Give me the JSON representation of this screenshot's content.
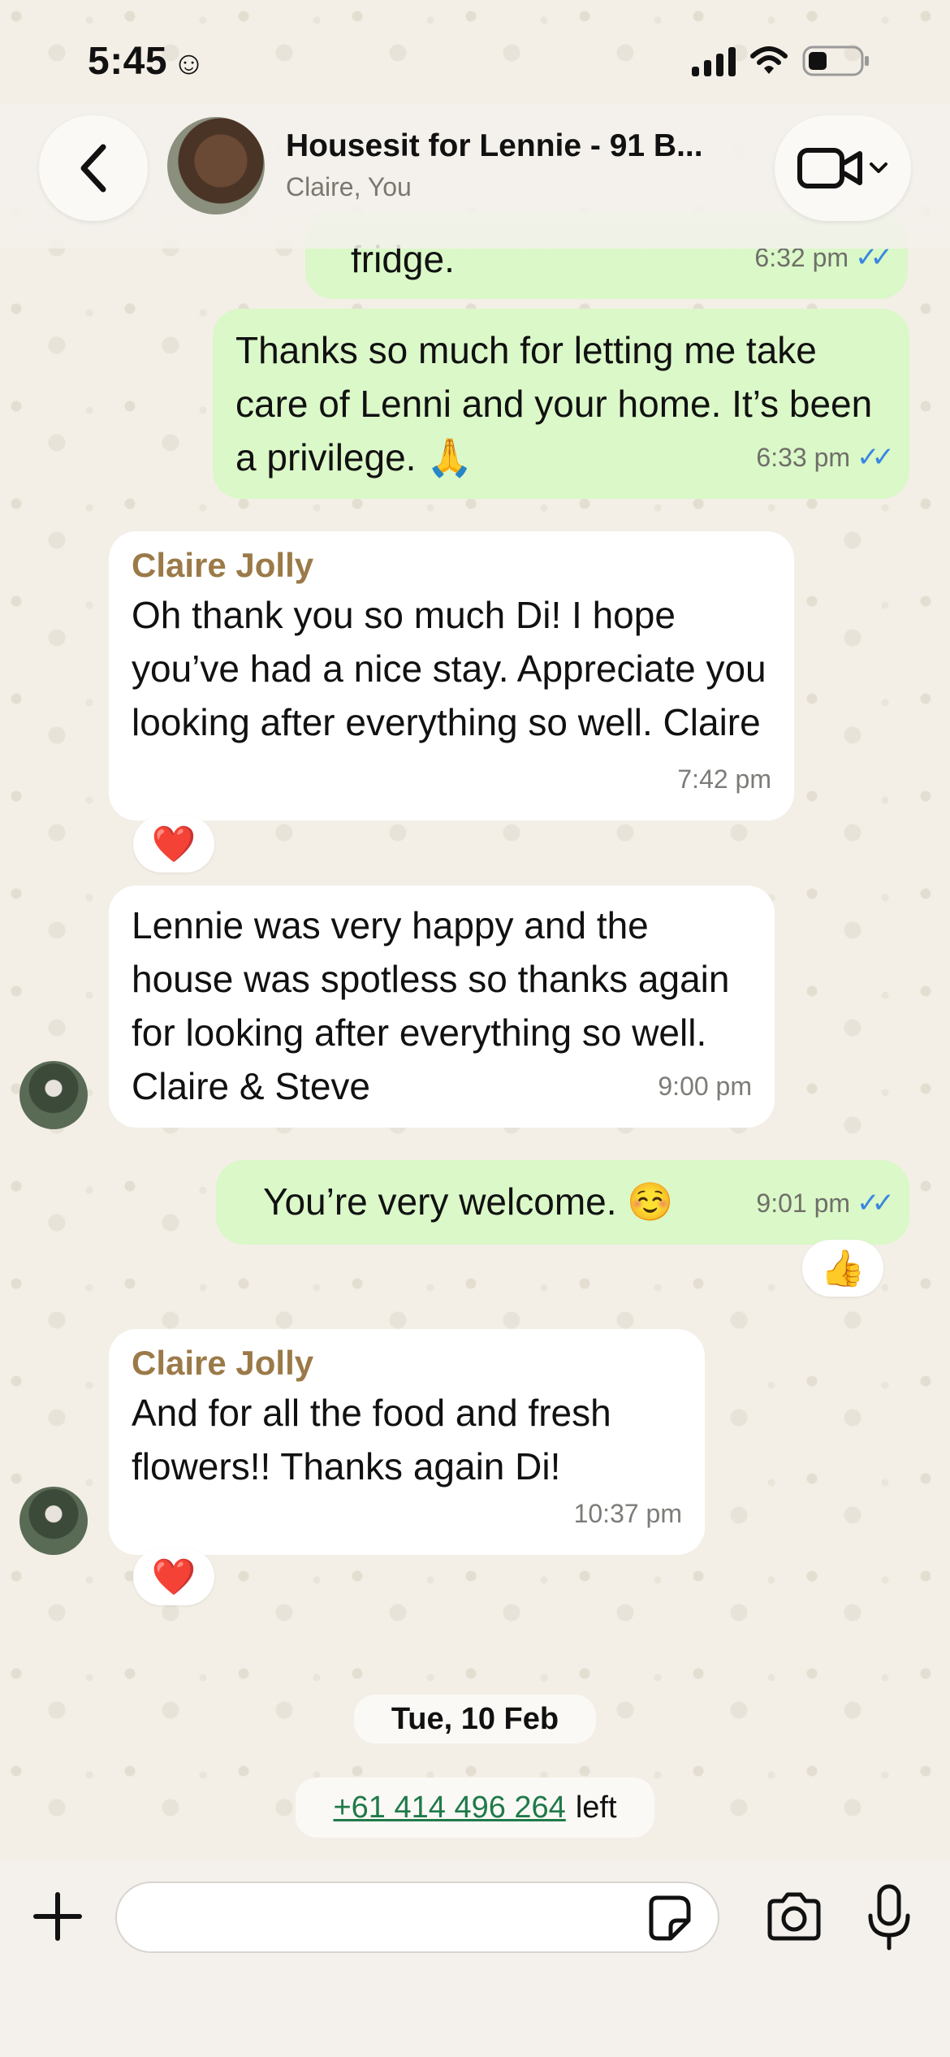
{
  "status_bar": {
    "time": "5:45",
    "time_emoji": "☺"
  },
  "header": {
    "title": "Housesit for Lennie - 91 B...",
    "participants": "Claire, You"
  },
  "messages": [
    {
      "type": "outgoing",
      "text": "fridge.",
      "time": "6:32 pm",
      "ticks": "✓✓"
    },
    {
      "type": "outgoing",
      "text": "Thanks so much for letting me take care of Lenni and your home. It’s been a privilege. 🙏",
      "time": "6:33 pm",
      "ticks": "✓✓"
    },
    {
      "type": "incoming",
      "sender": "Claire Jolly",
      "text": "Oh thank you so much Di! I hope you’ve had a nice stay. Appreciate you looking after everything so well. Claire",
      "time": "7:42 pm",
      "reaction": "❤️"
    },
    {
      "type": "incoming",
      "text": "Lennie was very happy and the house was spotless so thanks again for looking after everything so well. Claire & Steve",
      "time": "9:00 pm"
    },
    {
      "type": "outgoing",
      "text": "You’re very welcome. ☺️",
      "time": "9:01 pm",
      "ticks": "✓✓",
      "reaction": "👍"
    },
    {
      "type": "incoming",
      "sender": "Claire Jolly",
      "text": "And for all the food and fresh flowers!! Thanks again Di!",
      "time": "10:37 pm",
      "reaction": "❤️"
    }
  ],
  "date_divider": "Tue, 10 Feb",
  "system_event": {
    "phone": "+61 414 496 264",
    "action": "left"
  },
  "colors": {
    "outgoing_bubble": "#dbf8c8",
    "incoming_bubble": "#ffffff",
    "sender_name": "#9b7a48",
    "read_ticks": "#3a86e0",
    "link_green": "#1f7a4a"
  },
  "icons": [
    "back-chevron-icon",
    "video-call-icon",
    "chevron-down-icon",
    "plus-icon",
    "sticker-icon",
    "camera-icon",
    "microphone-icon",
    "signal-icon",
    "wifi-icon",
    "battery-icon"
  ]
}
